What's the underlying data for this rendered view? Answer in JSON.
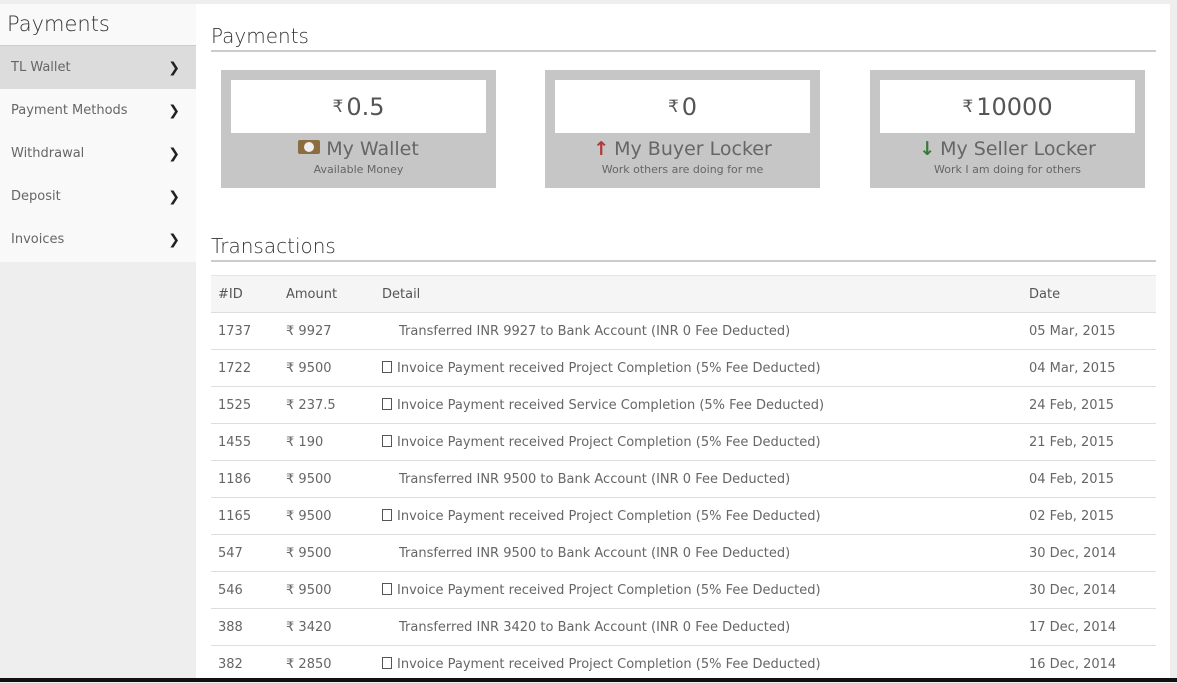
{
  "sidebar": {
    "title": "Payments",
    "items": [
      {
        "label": "TL Wallet",
        "active": true
      },
      {
        "label": "Payment Methods"
      },
      {
        "label": "Withdrawal"
      },
      {
        "label": "Deposit"
      },
      {
        "label": "Invoices"
      }
    ]
  },
  "main": {
    "title": "Payments",
    "currency_symbol": "₹",
    "cards": [
      {
        "value": "0.5",
        "name": "My Wallet",
        "sub": "Available Money",
        "icon": "money-icon"
      },
      {
        "value": "0",
        "name": "My Buyer Locker",
        "sub": "Work others are doing for me",
        "icon": "arrow-up-icon",
        "color": "#b03a3a"
      },
      {
        "value": "10000",
        "name": "My Seller Locker",
        "sub": "Work I am doing for others",
        "icon": "arrow-down-icon",
        "color": "#3a7a3a"
      }
    ],
    "transactions_title": "Transactions",
    "columns": [
      "#ID",
      "Amount",
      "Detail",
      "Date"
    ],
    "rows": [
      {
        "id": "1737",
        "amount": "9927",
        "detail": "Transferred INR 9927 to Bank Account (INR 0 Fee Deducted)",
        "date": "05 Mar, 2015",
        "pdf": false
      },
      {
        "id": "1722",
        "amount": "9500",
        "detail": "Invoice Payment received Project Completion (5% Fee Deducted)",
        "date": "04 Mar, 2015",
        "pdf": true
      },
      {
        "id": "1525",
        "amount": "237.5",
        "detail": "Invoice Payment received Service Completion (5% Fee Deducted)",
        "date": "24 Feb, 2015",
        "pdf": true
      },
      {
        "id": "1455",
        "amount": "190",
        "detail": "Invoice Payment received Project Completion (5% Fee Deducted)",
        "date": "21 Feb, 2015",
        "pdf": true
      },
      {
        "id": "1186",
        "amount": "9500",
        "detail": "Transferred INR 9500 to Bank Account (INR 0 Fee Deducted)",
        "date": "04 Feb, 2015",
        "pdf": false
      },
      {
        "id": "1165",
        "amount": "9500",
        "detail": "Invoice Payment received Project Completion (5% Fee Deducted)",
        "date": "02 Feb, 2015",
        "pdf": true
      },
      {
        "id": "547",
        "amount": "9500",
        "detail": "Transferred INR 9500 to Bank Account (INR 0 Fee Deducted)",
        "date": "30 Dec, 2014",
        "pdf": false
      },
      {
        "id": "546",
        "amount": "9500",
        "detail": "Invoice Payment received Project Completion (5% Fee Deducted)",
        "date": "30 Dec, 2014",
        "pdf": true
      },
      {
        "id": "388",
        "amount": "3420",
        "detail": "Transferred INR 3420 to Bank Account (INR 0 Fee Deducted)",
        "date": "17 Dec, 2014",
        "pdf": false
      },
      {
        "id": "382",
        "amount": "2850",
        "detail": "Invoice Payment received Project Completion (5% Fee Deducted)",
        "date": "16 Dec, 2014",
        "pdf": true
      }
    ]
  }
}
